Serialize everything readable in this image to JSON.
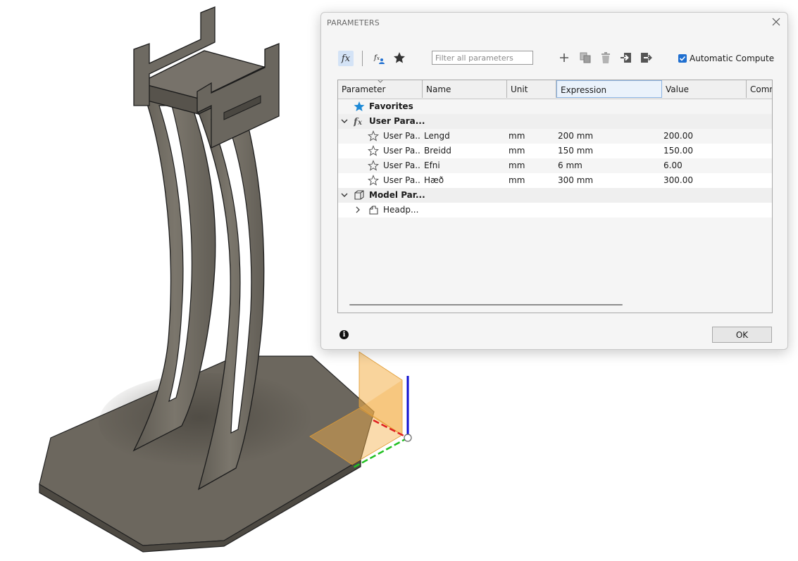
{
  "dialog": {
    "title": "PARAMETERS",
    "toolbar": {
      "fx_label": "fx",
      "filter_placeholder": "Filter all parameters",
      "auto_compute_label": "Automatic Compute",
      "auto_compute_checked": true
    },
    "table": {
      "columns": [
        "Parameter",
        "Name",
        "Unit",
        "Expression",
        "Value",
        "Comm"
      ],
      "groups": {
        "favorites": "Favorites",
        "user": "User Para...",
        "model": "Model Par..."
      },
      "user_rows": [
        {
          "parameter": "User Pa...",
          "name": "Lengd",
          "unit": "mm",
          "expression": "200 mm",
          "value": "200.00"
        },
        {
          "parameter": "User Pa...",
          "name": "Breidd",
          "unit": "mm",
          "expression": "150 mm",
          "value": "150.00"
        },
        {
          "parameter": "User Pa...",
          "name": "Efni",
          "unit": "mm",
          "expression": "6 mm",
          "value": "6.00"
        },
        {
          "parameter": "User Pa...",
          "name": "Hæð",
          "unit": "mm",
          "expression": "300 mm",
          "value": "300.00"
        }
      ],
      "model_rows": [
        {
          "parameter": "Headp..."
        }
      ]
    },
    "ok_label": "OK"
  },
  "colors": {
    "accent": "#1f6fd0",
    "fx_highlight": "#d4e3f6",
    "model_face": "#6f6a61",
    "axis_x": "#e02020",
    "axis_y": "#22c022",
    "axis_z": "#1010d0",
    "plane": "#f4b04a"
  }
}
